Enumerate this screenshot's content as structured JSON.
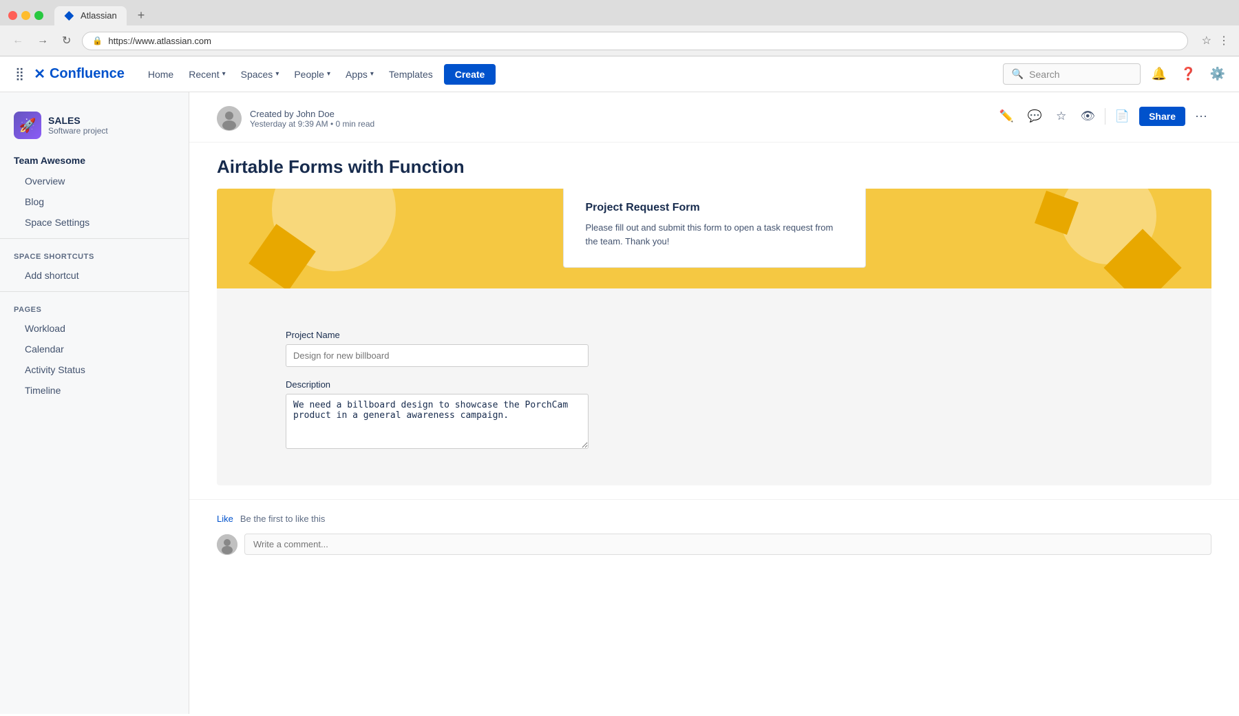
{
  "browser": {
    "tab_title": "Atlassian",
    "url": "https://www.atlassian.com",
    "new_tab_label": "+",
    "back_btn": "←",
    "forward_btn": "→",
    "reload_btn": "↻"
  },
  "nav": {
    "logo_text": "Confluence",
    "logo_icon": "✕",
    "home": "Home",
    "recent": "Recent",
    "spaces": "Spaces",
    "people": "People",
    "apps": "Apps",
    "templates": "Templates",
    "create": "Create",
    "search_placeholder": "Search"
  },
  "sidebar": {
    "space_icon": "🚀",
    "space_name": "SALES",
    "space_type": "Software project",
    "nav_item_main": "Team Awesome",
    "nav_overview": "Overview",
    "nav_blog": "Blog",
    "nav_space_settings": "Space Settings",
    "section_shortcuts": "SPACE SHORTCUTS",
    "add_shortcut": "Add shortcut",
    "section_pages": "PAGES",
    "page_workload": "Workload",
    "page_calendar": "Calendar",
    "page_activity": "Activity Status",
    "page_timeline": "Timeline"
  },
  "content": {
    "author_name": "Created by John Doe",
    "author_meta": "Yesterday at 9:39 AM  •  0 min read",
    "page_title": "Airtable Forms with Function",
    "share_btn": "Share",
    "form": {
      "form_title": "Project Request Form",
      "form_desc": "Please fill out and submit this form to open a task request from the team. Thank you!",
      "field_project_name": "Project Name",
      "field_project_placeholder": "Design for new billboard",
      "field_description": "Description",
      "field_description_value": "We need a billboard design to showcase the PorchCam product in a general awareness campaign."
    },
    "footer": {
      "like_label": "Like",
      "like_desc": "Be the first to like this",
      "comment_placeholder": "Write a comment..."
    }
  }
}
